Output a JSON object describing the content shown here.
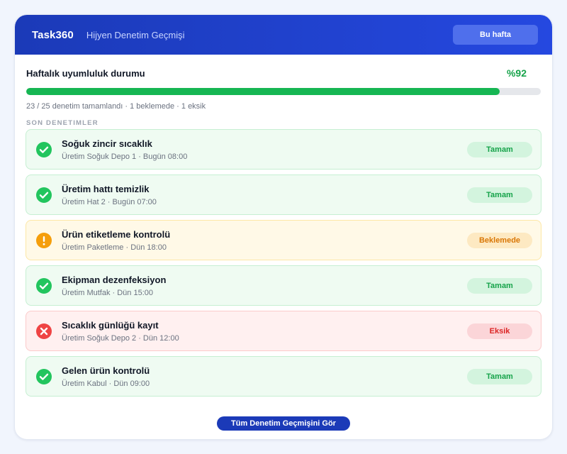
{
  "header": {
    "app_name": "Task360",
    "page_title": "Hijyen Denetim Geçmişi",
    "week_button": "Bu hafta"
  },
  "summary": {
    "title": "Haftalık uyumluluk durumu",
    "percent_label": "%92",
    "progress_fraction": 0.92,
    "meta": "23 / 25 denetim tamamlandı · 1 beklemede · 1 eksik"
  },
  "section_label": "SON DENETIMLER",
  "audits": [
    {
      "title": "Soğuk zincir sıcaklık",
      "subtitle": "Üretim Soğuk Depo 1 · Bugün 08:00",
      "status": "ok",
      "badge": "Tamam",
      "icon": "check-circle-icon"
    },
    {
      "title": "Üretim hattı temizlik",
      "subtitle": "Üretim Hat 2 · Bugün 07:00",
      "status": "ok",
      "badge": "Tamam",
      "icon": "check-circle-icon"
    },
    {
      "title": "Ürün etiketleme kontrolü",
      "subtitle": "Üretim Paketleme · Dün 18:00",
      "status": "pending",
      "badge": "Beklemede",
      "icon": "warning-circle-icon"
    },
    {
      "title": "Ekipman dezenfeksiyon",
      "subtitle": "Üretim Mutfak · Dün 15:00",
      "status": "ok",
      "badge": "Tamam",
      "icon": "check-circle-icon"
    },
    {
      "title": "Sıcaklık günlüğü kayıt",
      "subtitle": "Üretim Soğuk Depo 2 · Dün 12:00",
      "status": "missing",
      "badge": "Eksik",
      "icon": "x-circle-icon"
    },
    {
      "title": "Gelen ürün kontrolü",
      "subtitle": "Üretim Kabul · Dün 09:00",
      "status": "ok",
      "badge": "Tamam",
      "icon": "check-circle-icon"
    }
  ],
  "footer": {
    "history_button": "Tüm Denetim Geçmişini Gör"
  },
  "colors": {
    "brand": "#1b3ab8",
    "ok": "#22c55e",
    "pending": "#f59e0b",
    "missing": "#ef4444"
  }
}
